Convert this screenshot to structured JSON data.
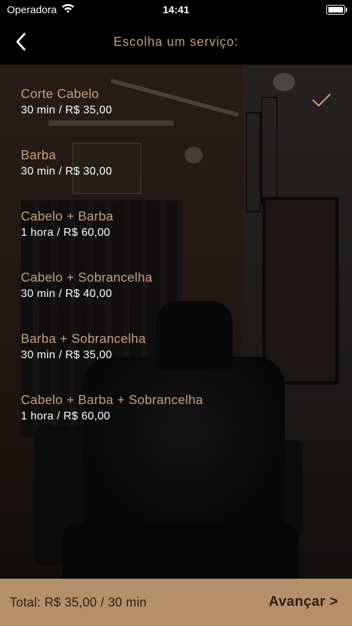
{
  "status_bar": {
    "carrier": "Operadora",
    "time": "14:41",
    "icons": [
      "wifi-icon",
      "battery-icon"
    ]
  },
  "nav": {
    "title": "Escolha um serviço:",
    "back_icon": "chevron-left-icon"
  },
  "services": [
    {
      "name": "Corte Cabelo",
      "details": "30 min / R$ 35,00",
      "selected": true
    },
    {
      "name": "Barba",
      "details": "30 min / R$ 30,00",
      "selected": false
    },
    {
      "name": "Cabelo + Barba",
      "details": "1 hora / R$ 60,00",
      "selected": false
    },
    {
      "name": "Cabelo + Sobrancelha",
      "details": "30 min / R$ 40,00",
      "selected": false
    },
    {
      "name": "Barba + Sobrancelha",
      "details": "30 min / R$ 35,00",
      "selected": false
    },
    {
      "name": "Cabelo + Barba + Sobrancelha",
      "details": "1 hora / R$ 60,00",
      "selected": false
    }
  ],
  "footer": {
    "total": "Total: R$ 35,00 / 30 min",
    "advance_label": "Avançar >"
  },
  "colors": {
    "accent": "#c6a07a",
    "footer_bg": "#b48f69",
    "footer_text": "#2e2118"
  }
}
